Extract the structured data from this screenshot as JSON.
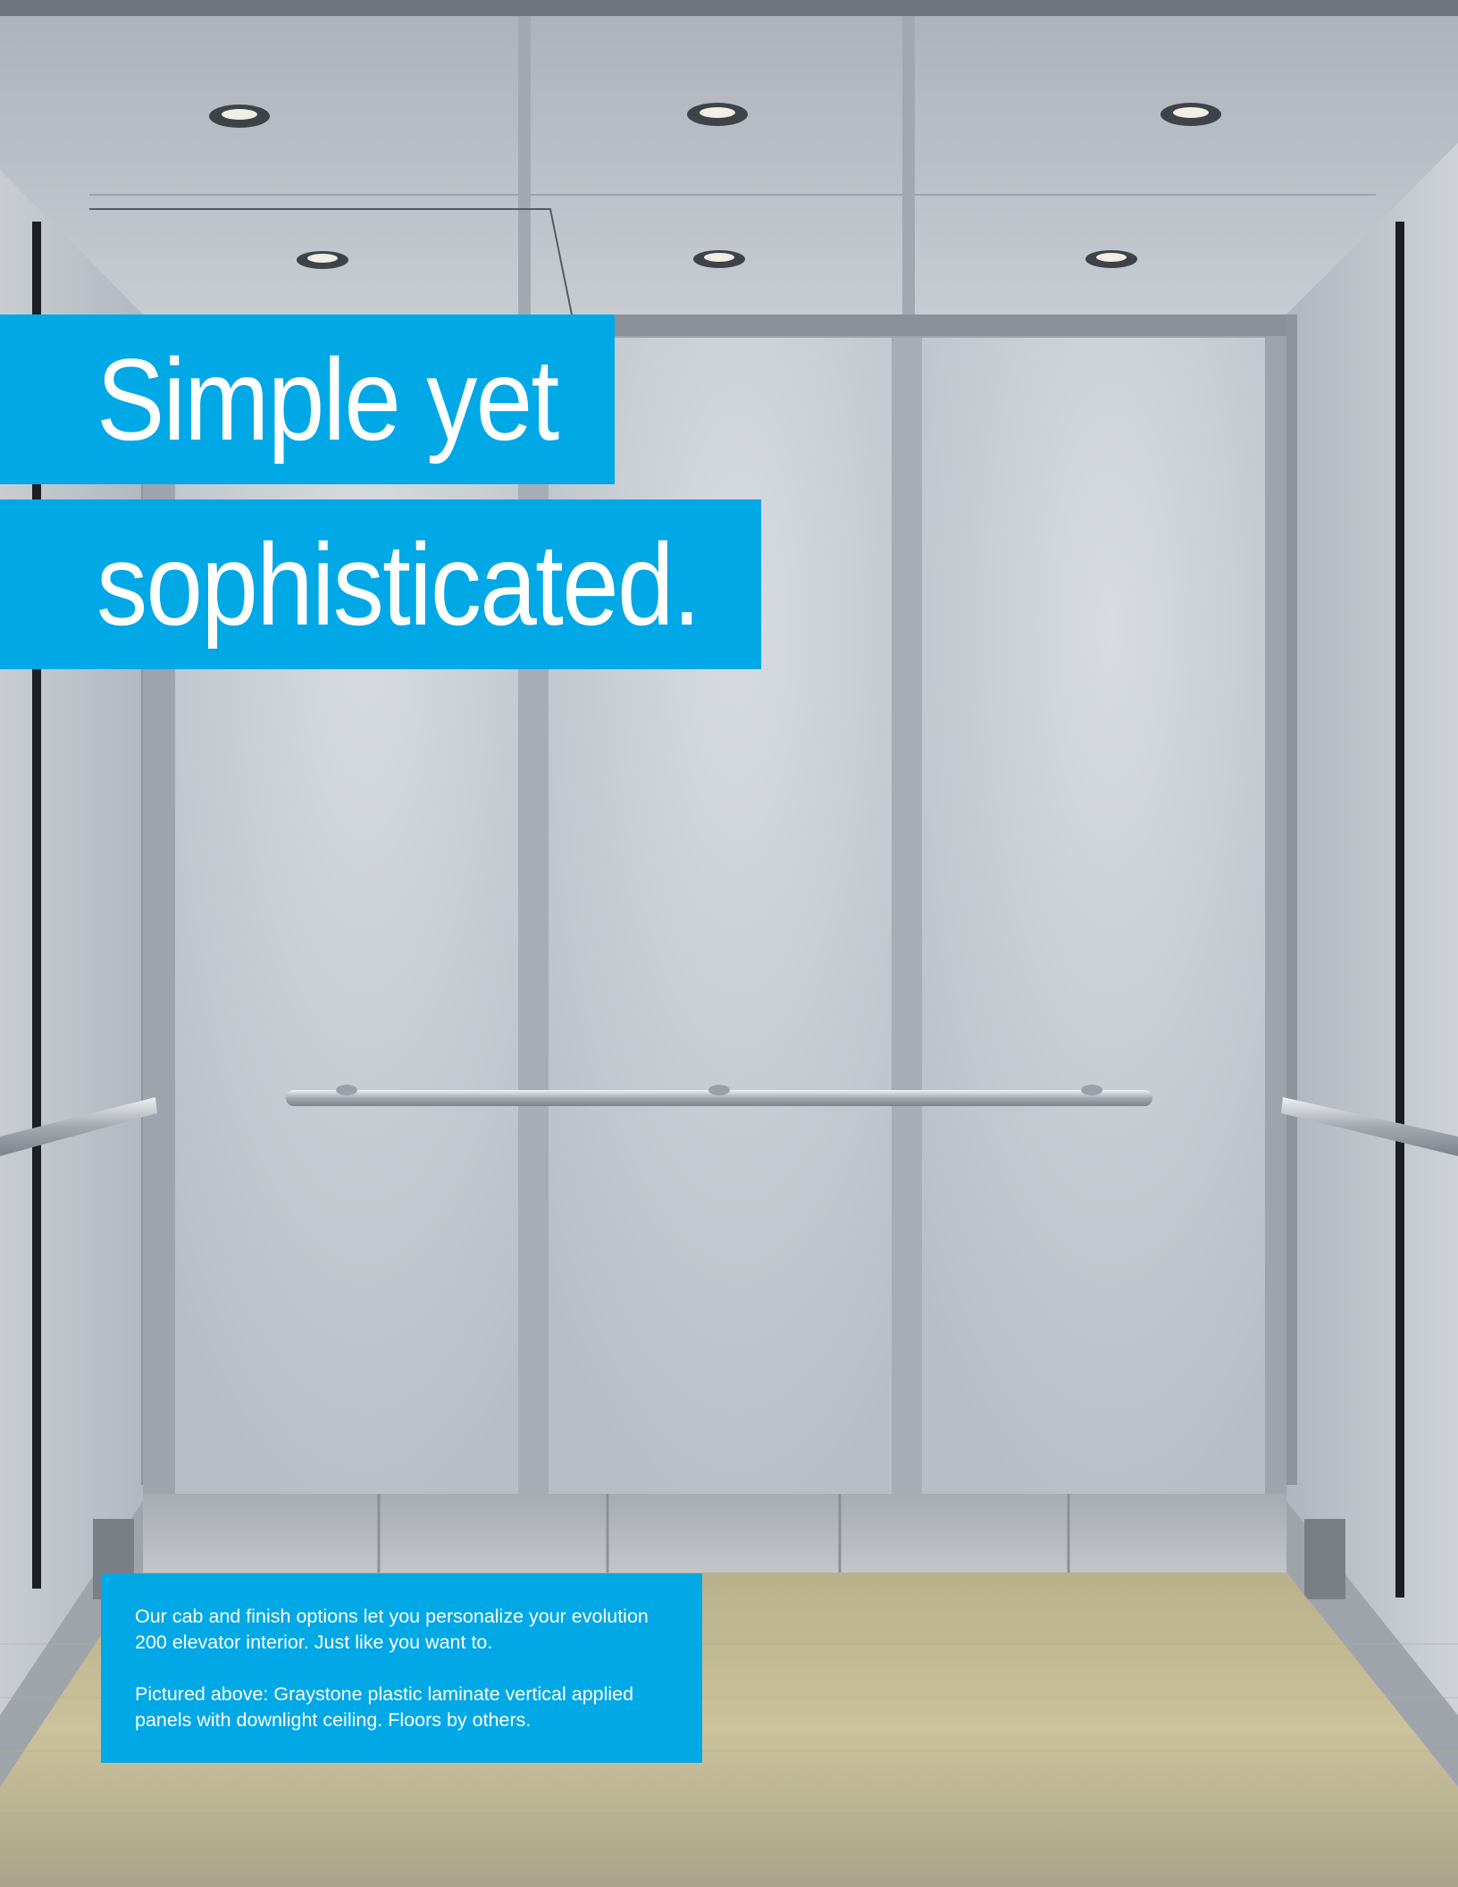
{
  "headline": {
    "line1": "Simple yet",
    "line2": "sophisticated."
  },
  "caption": {
    "paragraph1": "Our cab and finish options let you personalize your evolution 200 elevator interior. Just like you want to.",
    "paragraph2": "Pictured above: Graystone plastic laminate vertical applied panels with downlight ceiling. Floors by others."
  },
  "colors": {
    "accent_blue": "#00a8e6",
    "panel_gray": "#c4c9d0",
    "floor_wood": "#c9bf96"
  }
}
